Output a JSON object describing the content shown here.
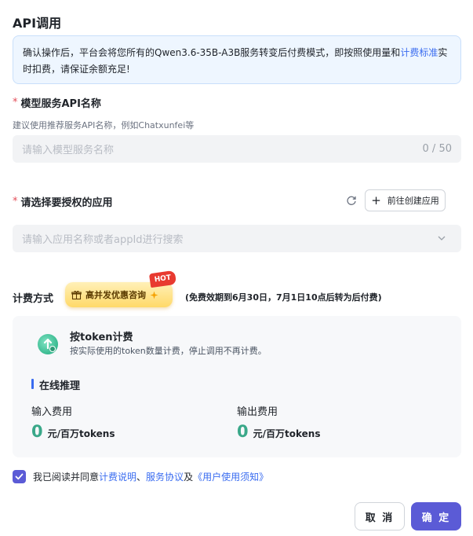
{
  "header": {
    "title": "API调用"
  },
  "notice": {
    "text_before": "确认操作后，平台会将您所有的Qwen3.6-35B-A3B服务转变后付费模式，即按照使用量和",
    "link": "计费标准",
    "text_after": "实时扣费，请保证余额充足!"
  },
  "service_name": {
    "required_mark": "*",
    "label": "模型服务API名称",
    "hint": "建议使用推荐服务API名称，例如Chatxunfei等",
    "placeholder": "请输入模型服务名称",
    "counter": "0 / 50"
  },
  "app_select": {
    "required_mark": "*",
    "label": "请选择要授权的应用",
    "create_button": "前往创建应用",
    "placeholder": "请输入应用名称或者appId进行搜索"
  },
  "billing": {
    "label": "计费方式",
    "promo_label": "高并发优惠咨询",
    "hot_badge": "HOT",
    "free_note": "(免费效期到6月30日，7月1日10点后转为后付费)"
  },
  "plan": {
    "title": "按token计费",
    "description": "按实际使用的token数量计费，停止调用不再计费。",
    "section_title": "在线推理",
    "input_fee_label": "输入费用",
    "input_fee_value": "0",
    "input_fee_unit": "元/百万tokens",
    "output_fee_label": "输出费用",
    "output_fee_value": "0",
    "output_fee_unit": "元/百万tokens"
  },
  "agreement": {
    "checked": true,
    "prefix": "我已阅读并同意",
    "link1": "计费说明",
    "sep1": "、",
    "link2": "服务协议",
    "sep2": "及",
    "link3": "《用户使用须知》"
  },
  "footer": {
    "cancel_label": "取 消",
    "confirm_label": "确 定"
  },
  "colors": {
    "primary": "#5b5bd6",
    "link": "#3a6cf0",
    "fee_value": "#3aa889",
    "required": "#e34d59"
  }
}
